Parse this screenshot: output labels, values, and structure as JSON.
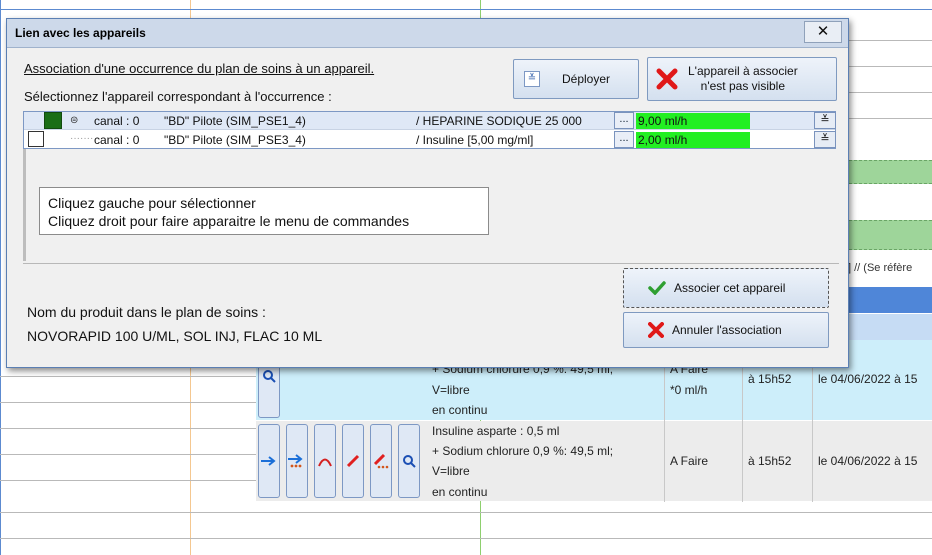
{
  "background": {
    "right_header_text": "] // (Se réfère",
    "rows": [
      {
        "description_lines": [
          "+ Sodium chlorure 0,9 %: 49,5 ml;",
          "V=libre",
          "en continu"
        ],
        "status": [
          "A Faire",
          "*0 ml/h"
        ],
        "time": "à 15h52",
        "date": "le 04/06/2022 à 15"
      },
      {
        "description_lines": [
          "Insuline asparte : 0,5 ml",
          "+ Sodium chlorure 0,9 %: 49,5 ml;",
          "V=libre",
          "en continu"
        ],
        "status": [
          "A Faire"
        ],
        "time": "à 15h52",
        "date": "le 04/06/2022 à 15"
      }
    ]
  },
  "dialog": {
    "title": "Lien avec les appareils",
    "close_label": "✕",
    "heading": "Association d'une occurrence du plan de soins à un appareil.",
    "instruction": "Sélectionnez l'appareil correspondant à l'occurrence :",
    "deploy_label": "Déployer",
    "not_visible_label_1": "L'appareil à associer",
    "not_visible_label_2": "n'est pas visible",
    "devices": [
      {
        "canal": "canal : 0",
        "pilot": "\"BD\" Pilote (SIM_PSE1_4)",
        "product": "/ HEPARINE SODIQUE 25 000",
        "flow": "9,00 ml/h",
        "selected": true
      },
      {
        "canal": "canal : 0",
        "pilot": "\"BD\" Pilote (SIM_PSE3_4)",
        "product": "/ Insuline [5,00 mg/ml]",
        "flow": "2,00 ml/h",
        "selected": false
      }
    ],
    "dots_label": "...",
    "expand_label": "≚",
    "tooltip_line1": "Cliquez gauche pour sélectionner",
    "tooltip_line2": "Cliquez droit pour faire apparaitre le menu de commandes",
    "product_label": "Nom du produit dans le plan de soins :",
    "product_name": "NOVORAPID 100 U/ML, SOL INJ, FLAC 10 ML",
    "associate_label": "Associer cet appareil",
    "cancel_label": "Annuler l'association"
  },
  "colors": {
    "flow_green": "#22ef22",
    "accent_blue": "#5b7fb3"
  }
}
